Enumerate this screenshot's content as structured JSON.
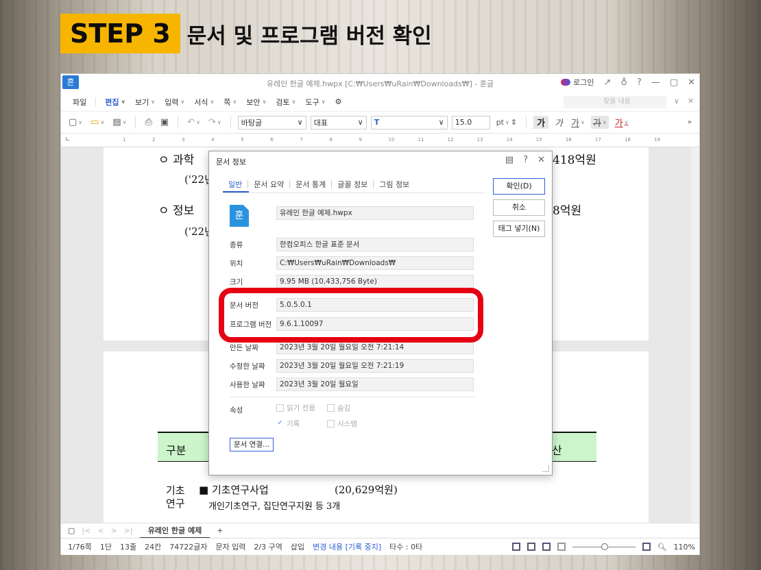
{
  "step": {
    "badge": "STEP 3",
    "title": "문서 및 프로그램 버전 확인"
  },
  "window": {
    "logo": "흔",
    "title": "유레인 한글 예제.hwpx [C:₩Users₩uRain₩Downloads₩] - 훈글",
    "login": "로그인",
    "controls": [
      "↗",
      "♁",
      "?",
      "—",
      "▢",
      "✕"
    ]
  },
  "menubar": {
    "items": [
      "파일",
      "편집",
      "보기",
      "입력",
      "서식",
      "쪽",
      "보안",
      "검토",
      "도구"
    ],
    "find_placeholder": "찾을 내용"
  },
  "toolbar": {
    "style_select": "바탕글",
    "font_select": "대표",
    "font_icon": "T",
    "font_size": "15.0",
    "unit": "pt",
    "buttons": [
      "가",
      "가",
      "가",
      "가",
      "가"
    ]
  },
  "ruler": {
    "ticks": [
      "1",
      "2",
      "3",
      "4",
      "5",
      "6",
      "7",
      "8",
      "9",
      "10",
      "11",
      "12",
      "13",
      "14",
      "15",
      "16",
      "17",
      "18",
      "19"
    ]
  },
  "document": {
    "line1_left": "ㅇ 과학",
    "line1_right": "418억원",
    "line2_left": "('22년",
    "line3_left": "ㅇ 정보",
    "line3_right": "8억원",
    "line4_left": "('22년",
    "table_header_left": "구분",
    "table_header_right": "산",
    "row_label_1": "기초",
    "row_label_2": "연구",
    "row_title": "■ 기초연구사업",
    "row_amount": "(20,629억원)",
    "row_sub": "개인기초연구, 집단연구지원 등 3개"
  },
  "statusbar": {
    "doc_tab": "유레인 한글 예제",
    "page": "1/76쪽",
    "col": "1단",
    "line": "13줄",
    "char_pos": "24칸",
    "char_count": "74722글자",
    "mode": "문자 입력",
    "section": "2/3 구역",
    "insert": "삽입",
    "track": "변경 내용 [기록 중지]",
    "typing": "타수 : 0타",
    "zoom": "110%"
  },
  "dialog": {
    "title": "문서 정보",
    "tabs": [
      "일반",
      "문서 요약",
      "문서 통계",
      "글꼴 정보",
      "그림 정보"
    ],
    "buttons": {
      "ok": "확인(D)",
      "cancel": "취소",
      "tag": "태그 넣기(N)"
    },
    "file_icon": "훈",
    "file_name": "유레인 한글 예제.hwpx",
    "fields": [
      {
        "label": "종류",
        "value": "한컴오피스 한글 표준 문서"
      },
      {
        "label": "위치",
        "value": "C:₩Users₩uRain₩Downloads₩"
      },
      {
        "label": "크기",
        "value": "9.95 MB (10,433,756 Byte)"
      },
      {
        "label": "문서 버전",
        "value": "5.0.5.0.1"
      },
      {
        "label": "프로그램 버전",
        "value": "9.6.1.10097"
      },
      {
        "label": "만든 날짜",
        "value": "2023년 3월 20일 월요일 오전 7:21:14"
      },
      {
        "label": "수정한 날짜",
        "value": "2023년 3월 20일 월요일 오전 7:21:19"
      },
      {
        "label": "사용한 날짜",
        "value": "2023년 3월 20일 월요일"
      }
    ],
    "attr_label": "속성",
    "attrs": {
      "readonly": "읽기 전용",
      "hidden": "숨김",
      "archive": "기록",
      "system": "시스템"
    },
    "link_button": "문서 연결..."
  },
  "colors": {
    "badge": "#f7b500",
    "highlight": "#e60012",
    "accent": "#2f5fd1"
  }
}
